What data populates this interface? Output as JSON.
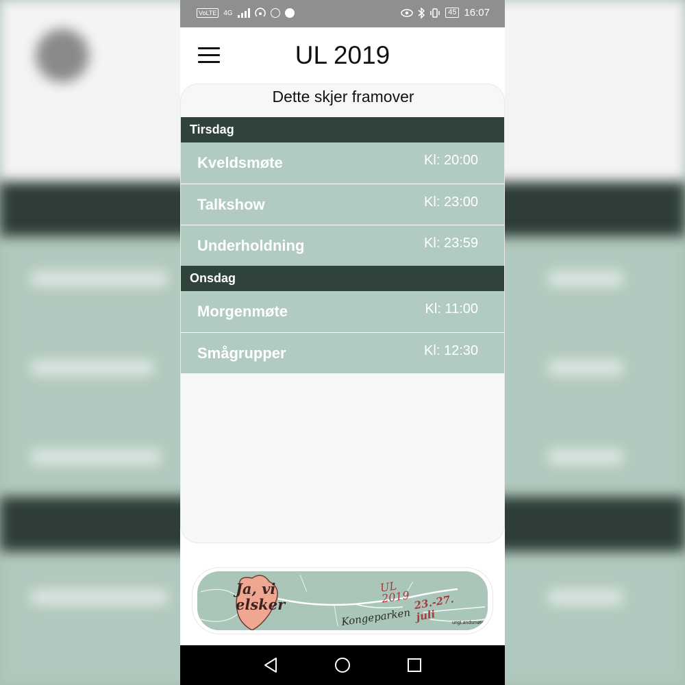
{
  "status_bar": {
    "left_tags": [
      "VoLTE",
      "4G"
    ],
    "right_time": "16:07",
    "battery": "45",
    "icons": [
      "volte-icon",
      "signal-icon",
      "hotspot-icon",
      "spotify-icon",
      "vpn-icon",
      "eye-icon",
      "bluetooth-icon",
      "vibrate-icon",
      "battery-icon"
    ]
  },
  "app": {
    "title": "UL 2019",
    "menu_icon": "hamburger-menu-icon"
  },
  "card": {
    "title": "Dette skjer framover"
  },
  "schedule": {
    "days": [
      {
        "name": "Tirsdag",
        "events": [
          {
            "name": "Kveldsmøte",
            "time": "Kl: 20:00"
          },
          {
            "name": "Talkshow",
            "time": "Kl: 23:00"
          },
          {
            "name": "Underholdning",
            "time": "Kl: 23:59"
          }
        ]
      },
      {
        "name": "Onsdag",
        "events": [
          {
            "name": "Morgenmøte",
            "time": "Kl: 11:00"
          },
          {
            "name": "Smågrupper",
            "time": "Kl: 12:30"
          }
        ]
      }
    ]
  },
  "banner": {
    "script_text": "Ja, vi elsker",
    "event_name": "UL 2019",
    "location": "Kongeparken",
    "dates": "23.-27. juli",
    "organizer": "ungLandsmøte"
  },
  "colors": {
    "day_header": "#30433b",
    "event_row": "#b2cbc0",
    "banner_bg": "#aac6b9",
    "heart": "#f0a792",
    "banner_red": "#a83a3f"
  },
  "nav_bar": {
    "icons": [
      "back-icon",
      "home-icon",
      "recents-icon"
    ]
  }
}
